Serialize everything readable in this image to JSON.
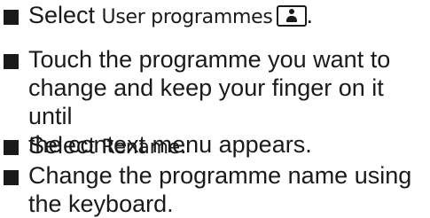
{
  "steps": [
    {
      "prefix": "Select ",
      "ui_term": "User programmes",
      "icon": "user-programmes-icon",
      "suffix": "."
    },
    {
      "lines": [
        "Touch the programme you want to",
        "change and keep your finger on it until",
        "the context menu appears."
      ]
    },
    {
      "prefix": "Select ",
      "ui_term": "Rename",
      "suffix": "."
    },
    {
      "lines": [
        "Change the programme name using",
        "the keyboard."
      ]
    }
  ]
}
